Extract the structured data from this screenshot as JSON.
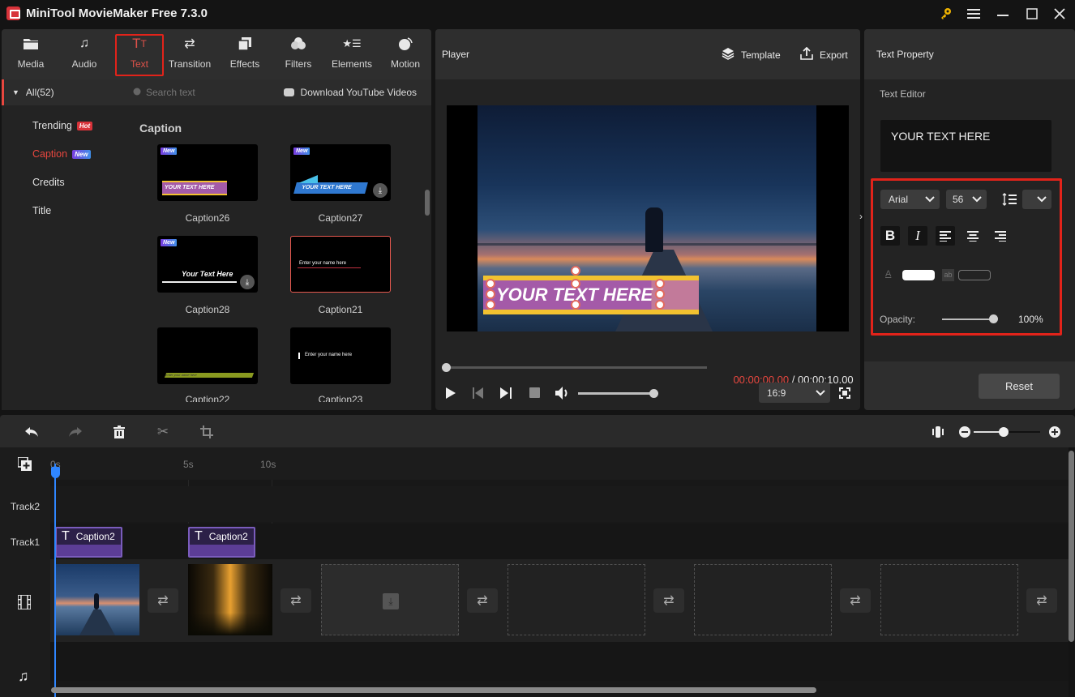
{
  "window": {
    "title": "MiniTool MovieMaker Free 7.3.0",
    "controls": [
      "key-icon",
      "menu-icon",
      "minimize-icon",
      "maximize-icon",
      "close-icon"
    ]
  },
  "toolbar": {
    "tabs": [
      {
        "label": "Media",
        "icon": "folder-icon"
      },
      {
        "label": "Audio",
        "icon": "music-note-icon"
      },
      {
        "label": "Text",
        "icon": "text-icon",
        "active": true
      },
      {
        "label": "Transition",
        "icon": "transition-arrows-icon"
      },
      {
        "label": "Effects",
        "icon": "effects-icon"
      },
      {
        "label": "Filters",
        "icon": "filters-icon"
      },
      {
        "label": "Elements",
        "icon": "elements-icon"
      },
      {
        "label": "Motion",
        "icon": "motion-icon"
      }
    ]
  },
  "categories": {
    "all_label": "All(52)",
    "items": [
      {
        "label": "Trending",
        "badge": "Hot",
        "badge_color": "#d8333a"
      },
      {
        "label": "Caption",
        "badge": "New",
        "badge_color": "#5a52e0",
        "active": true
      },
      {
        "label": "Credits"
      },
      {
        "label": "Title"
      }
    ]
  },
  "library": {
    "search_placeholder": "Search text",
    "download_link": "Download YouTube Videos",
    "section_title": "Caption",
    "items": [
      {
        "name": "Caption26",
        "is_new": true,
        "new_label": "New",
        "preview_text": "YOUR TEXT HERE"
      },
      {
        "name": "Caption27",
        "is_new": true,
        "new_label": "New",
        "preview_text": "YOUR TEXT HERE",
        "downloadable": true
      },
      {
        "name": "Caption28",
        "is_new": true,
        "new_label": "New",
        "preview_text": "Your Text Here",
        "downloadable": true
      },
      {
        "name": "Caption21",
        "selected": true,
        "preview_text": "Enter your name here"
      },
      {
        "name": "Caption22",
        "preview_text": "Enter your name here"
      },
      {
        "name": "Caption23",
        "preview_text": "Enter your name here"
      }
    ]
  },
  "player": {
    "title": "Player",
    "template_label": "Template",
    "export_label": "Export",
    "overlay_text": "YOUR TEXT HERE",
    "current_time": "00:00:00.00",
    "separator": " / ",
    "total_time": "00:00:10.00",
    "progress": 0,
    "volume": 1.0,
    "aspect_ratio": "16:9",
    "colors": {
      "current_time": "#e8473f"
    }
  },
  "properties": {
    "title": "Text Property",
    "editor_label": "Text Editor",
    "editor_text": "YOUR TEXT HERE",
    "font": "Arial",
    "size": "56",
    "line_spacing": "",
    "bold": true,
    "italic": true,
    "align": "left",
    "text_color": "#ffffff",
    "bg_color": "transparent",
    "opacity_label": "Opacity:",
    "opacity_value": "100%",
    "opacity": 1.0,
    "reset_label": "Reset"
  },
  "timeline": {
    "ruler_ticks": [
      "0s",
      "5s",
      "10s"
    ],
    "tracks": [
      "Track2",
      "Track1"
    ],
    "caption_clips": [
      {
        "label": "Caption2",
        "icon": "T"
      },
      {
        "label": "Caption2",
        "icon": "T"
      }
    ],
    "video_clips": [
      "sunset-pier",
      "forest-light"
    ],
    "empty_slots": 4,
    "zoom_level": 0.45
  }
}
